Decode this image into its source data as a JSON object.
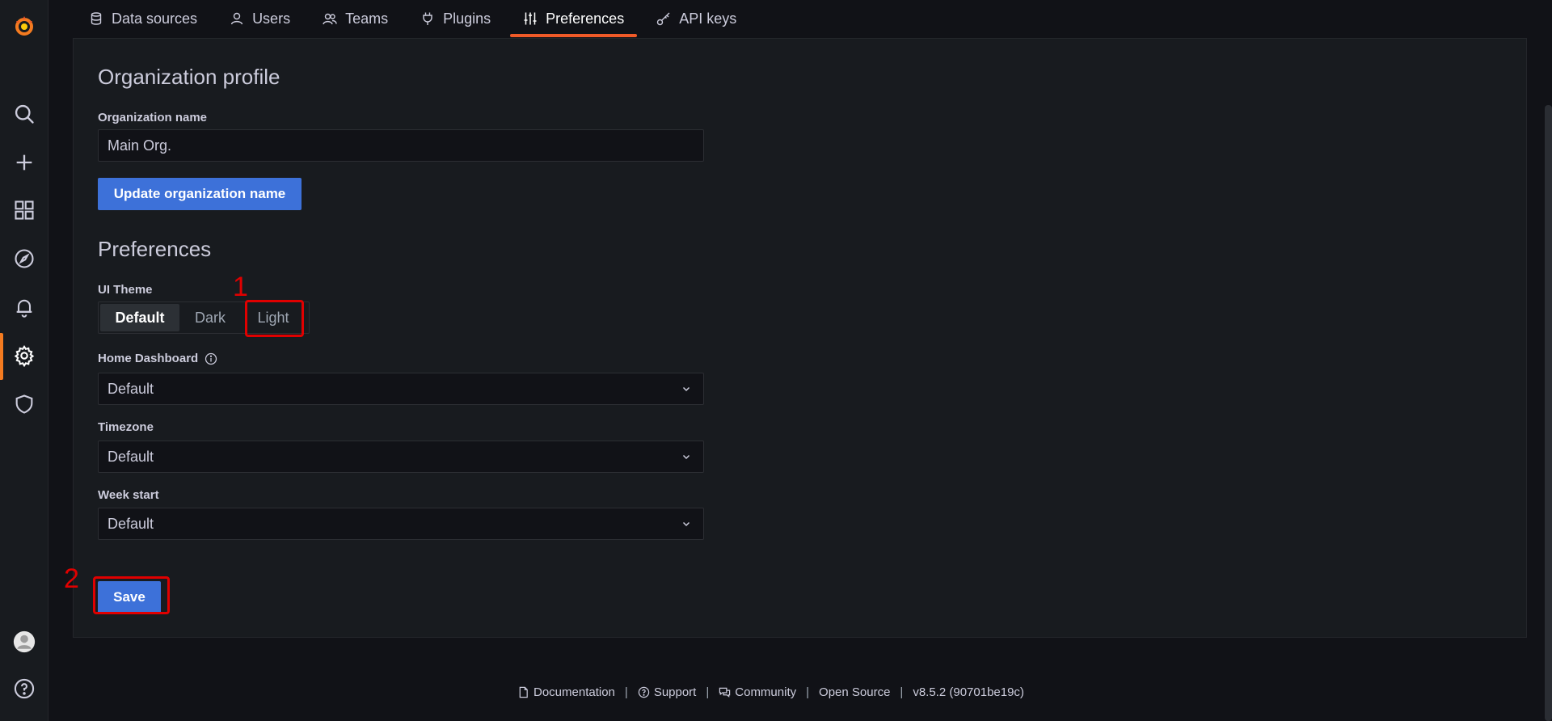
{
  "tabs": [
    {
      "label": "Data sources",
      "icon": "database-icon"
    },
    {
      "label": "Users",
      "icon": "user-icon"
    },
    {
      "label": "Teams",
      "icon": "users-icon"
    },
    {
      "label": "Plugins",
      "icon": "plug-icon"
    },
    {
      "label": "Preferences",
      "icon": "sliders-icon",
      "active": true
    },
    {
      "label": "API keys",
      "icon": "key-icon"
    }
  ],
  "sidebar": {
    "items": [
      "grafana-logo",
      "search-icon",
      "plus-icon",
      "dashboards-icon",
      "explore-icon",
      "alert-bell-icon",
      "gear-icon",
      "shield-icon",
      "avatar",
      "help-icon"
    ],
    "active": "gear-icon"
  },
  "org": {
    "section_title": "Organization profile",
    "name_label": "Organization name",
    "name_value": "Main Org.",
    "update_button": "Update organization name"
  },
  "prefs": {
    "section_title": "Preferences",
    "theme_label": "UI Theme",
    "theme_options": [
      "Default",
      "Dark",
      "Light"
    ],
    "theme_selected": "Default",
    "home_label": "Home Dashboard",
    "home_value": "Default",
    "timezone_label": "Timezone",
    "timezone_value": "Default",
    "week_label": "Week start",
    "week_value": "Default",
    "save_button": "Save"
  },
  "annotations": {
    "one": "1",
    "two": "2"
  },
  "footer": {
    "documentation": "Documentation",
    "support": "Support",
    "community": "Community",
    "open_source": "Open Source",
    "version": "v8.5.2 (90701be19c)",
    "separator": "|"
  },
  "colors": {
    "accent": "#f05a28",
    "primary": "#3d71d9",
    "annotation": "#e00000",
    "background": "#111217",
    "panel": "#181b1f"
  }
}
